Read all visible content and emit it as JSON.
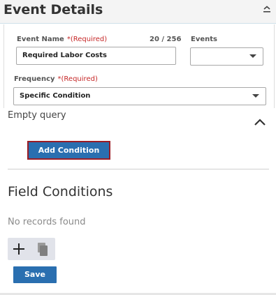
{
  "header": {
    "title": "Event Details"
  },
  "form": {
    "event_name": {
      "label": "Event Name",
      "required": "*(Required)",
      "counter": "20 / 256",
      "value": "Required Labor Costs"
    },
    "events": {
      "label": "Events",
      "value": ""
    },
    "frequency": {
      "label": "Frequency",
      "required": "*(Required)",
      "value": "Specific Condition"
    }
  },
  "query": {
    "status": "Empty query",
    "add_condition_label": "Add Condition"
  },
  "field_conditions": {
    "title": "Field Conditions",
    "empty_text": "No records found"
  },
  "actions": {
    "save_label": "Save"
  },
  "icons": {
    "collapse": "collapse-icon",
    "dropdown": "caret-down-icon",
    "chevron": "chevron-up-icon",
    "add": "plus-icon",
    "copy": "copy-icon"
  },
  "colors": {
    "primary": "#2a6fb0",
    "required": "#c62828",
    "focus_border": "#9b1c24",
    "header_bg": "#f4f4f4",
    "toolbar_bg": "#e1e3ea"
  }
}
